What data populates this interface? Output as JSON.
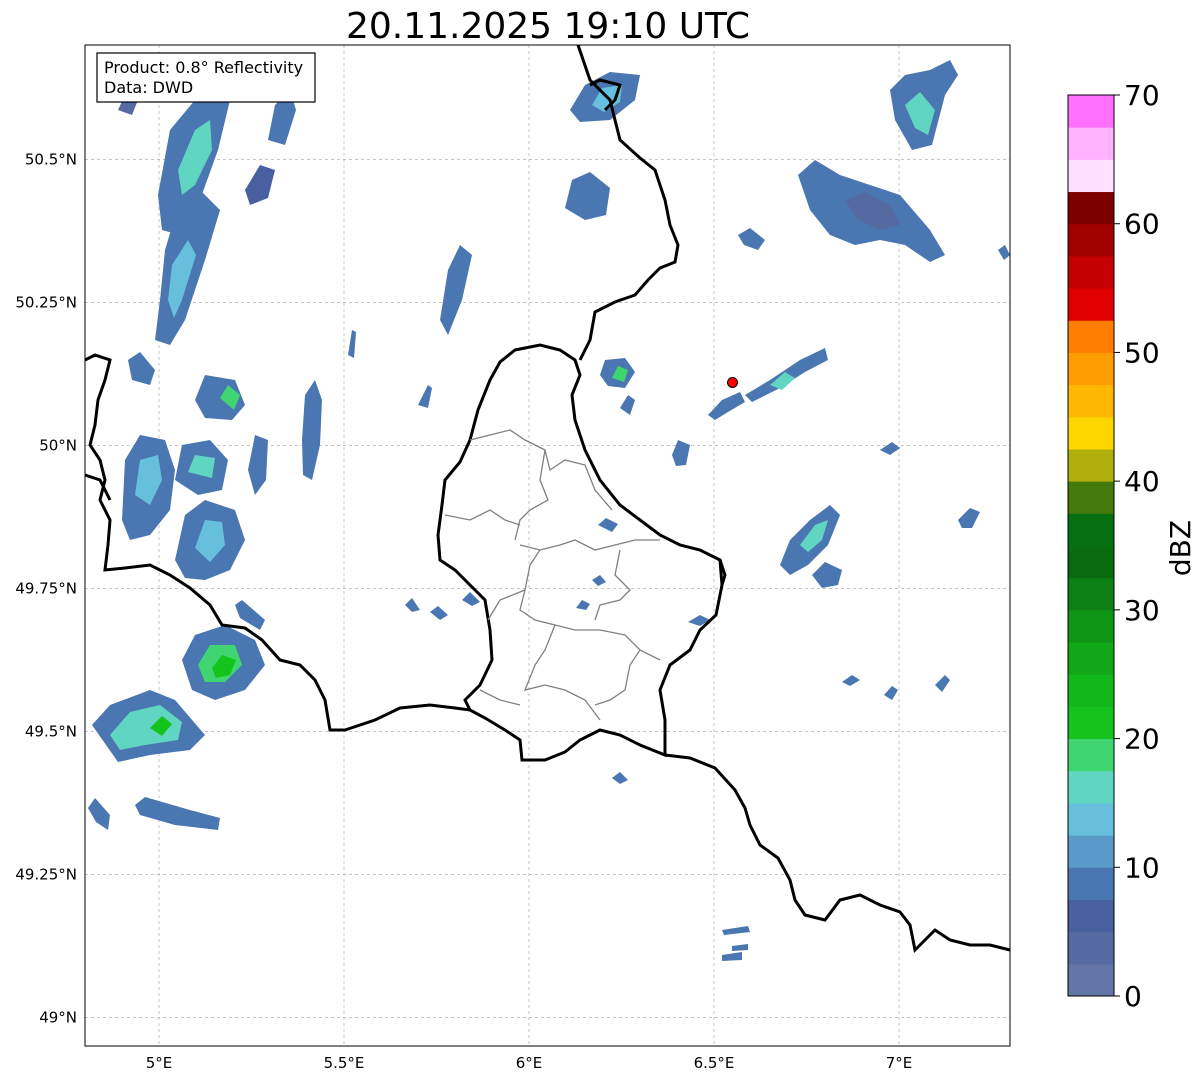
{
  "title": "20.11.2025 19:10 UTC",
  "info_box": {
    "product_line": "Product: 0.8° Reflectivity",
    "data_line": "Data: DWD"
  },
  "map": {
    "lon_range": [
      4.8,
      7.3
    ],
    "lat_range": [
      48.95,
      50.7
    ],
    "lon_ticks": [
      5.0,
      5.5,
      6.0,
      6.5,
      7.0
    ],
    "lon_tick_labels": [
      "5°E",
      "5.5°E",
      "6°E",
      "6.5°E",
      "7°E"
    ],
    "lat_ticks": [
      49.0,
      49.25,
      49.5,
      49.75,
      50.0,
      50.25,
      50.5
    ],
    "lat_tick_labels": [
      "49°N",
      "49.25°N",
      "49.5°N",
      "49.75°N",
      "50°N",
      "50.25°N",
      "50.5°N"
    ],
    "gridlines": true,
    "radar_site": {
      "lon": 6.55,
      "lat": 50.11,
      "color": "#ff0000"
    }
  },
  "colorbar": {
    "label": "dBZ",
    "min": 0,
    "max": 70,
    "step": 2.5,
    "tick_values": [
      0,
      10,
      20,
      30,
      40,
      50,
      60,
      70
    ],
    "tick_labels": [
      "0",
      "10",
      "20",
      "30",
      "40",
      "50",
      "60",
      "70"
    ],
    "colors": [
      "#6475a8",
      "#566aa2",
      "#48609f",
      "#4a76b1",
      "#5a9bc9",
      "#66bfdd",
      "#5fd5c2",
      "#3fd672",
      "#14c31c",
      "#12b81a",
      "#11a817",
      "#0f9616",
      "#0c8012",
      "#0a6b0e",
      "#067010",
      "#447a0c",
      "#b0b00c",
      "#ffd500",
      "#ffb700",
      "#ff9e00",
      "#ff7e00",
      "#e00000",
      "#c40000",
      "#a00000",
      "#7c0000",
      "#ffe0ff",
      "#ffb2ff",
      "#ff70ff",
      "#ec38ec"
    ]
  },
  "colors": {
    "border_major": "#000000",
    "border_minor": "#808080",
    "grid": "#b0b0b0"
  }
}
